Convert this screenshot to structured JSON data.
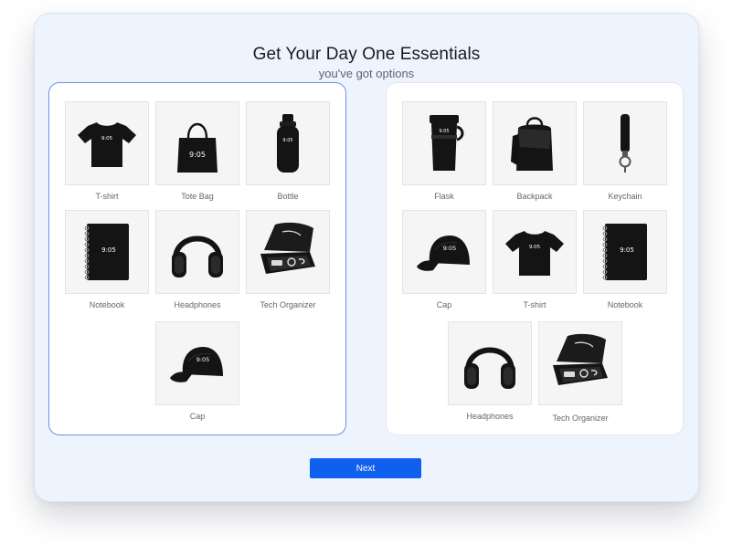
{
  "header": {
    "title": "Get Your Day One Essentials",
    "subtitle": "you've got options"
  },
  "brand_mark": "9:05",
  "option_a": {
    "items": [
      {
        "label": "T-shirt",
        "icon": "tshirt-icon"
      },
      {
        "label": "Tote Bag",
        "icon": "tote-bag-icon"
      },
      {
        "label": "Bottle",
        "icon": "bottle-icon"
      },
      {
        "label": "Notebook",
        "icon": "notebook-icon"
      },
      {
        "label": "Headphones",
        "icon": "headphones-icon"
      },
      {
        "label": "Tech Organizer",
        "icon": "tech-organizer-icon"
      },
      {
        "label": "Cap",
        "icon": "cap-icon"
      }
    ]
  },
  "option_b": {
    "items": [
      {
        "label": "Flask",
        "icon": "flask-icon"
      },
      {
        "label": "Backpack",
        "icon": "backpack-icon"
      },
      {
        "label": "Keychain",
        "icon": "keychain-icon"
      },
      {
        "label": "Cap",
        "icon": "cap-icon"
      },
      {
        "label": "T-shirt",
        "icon": "tshirt-icon"
      },
      {
        "label": "Notebook",
        "icon": "notebook-icon"
      },
      {
        "label": "Headphones",
        "icon": "headphones-icon"
      },
      {
        "label": "Tech Organizer",
        "icon": "tech-organizer-icon"
      }
    ]
  },
  "actions": {
    "next_label": "Next"
  },
  "colors": {
    "accent": "#1060f0",
    "selected_border": "#6d92e3",
    "card_background": "#eef4fe",
    "product": "#141414"
  }
}
